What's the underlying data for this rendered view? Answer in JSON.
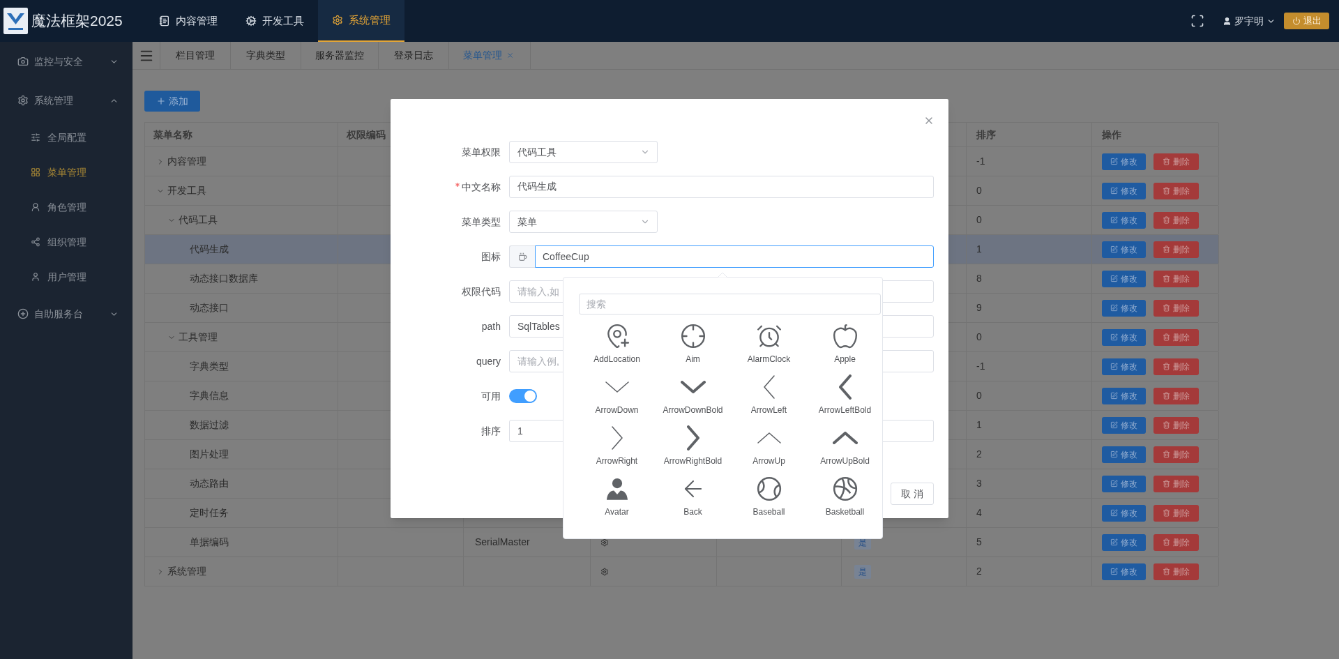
{
  "header": {
    "title": "魔法框架2025",
    "nav": [
      {
        "label": "内容管理",
        "selected": false
      },
      {
        "label": "开发工具",
        "selected": false
      },
      {
        "label": "系统管理",
        "selected": true
      }
    ],
    "user": "罗宇明",
    "logout": "退出"
  },
  "sidebar": {
    "items": [
      {
        "label": "监控与安全",
        "expanded": false
      },
      {
        "label": "系统管理",
        "expanded": true,
        "children": [
          {
            "label": "全局配置",
            "selected": false
          },
          {
            "label": "菜单管理",
            "selected": true
          },
          {
            "label": "角色管理",
            "selected": false
          },
          {
            "label": "组织管理",
            "selected": false
          },
          {
            "label": "用户管理",
            "selected": false
          }
        ]
      },
      {
        "label": "自助服务台",
        "expanded": false
      }
    ]
  },
  "tabs": [
    {
      "label": "栏目管理",
      "selected": false,
      "closable": false
    },
    {
      "label": "字典类型",
      "selected": false,
      "closable": false
    },
    {
      "label": "服务器监控",
      "selected": false,
      "closable": false
    },
    {
      "label": "登录日志",
      "selected": false,
      "closable": false
    },
    {
      "label": "菜单管理",
      "selected": true,
      "closable": true
    }
  ],
  "add_button": "添加",
  "table": {
    "columns": {
      "name": "菜单名称",
      "permission_code": "权限编码",
      "sort": "排序",
      "actions": "操作"
    },
    "rows": [
      {
        "name": "内容管理",
        "expanded": false,
        "selected": false,
        "sort": "-1",
        "actions": [
          "修改",
          "删除"
        ]
      },
      {
        "name": "开发工具",
        "expanded": true,
        "selected": false,
        "sort": "0",
        "actions": [
          "修改",
          "删除"
        ],
        "children": [
          {
            "name": "代码工具",
            "expanded": true,
            "selected": false,
            "sort": "0",
            "actions": [
              "修改",
              "删除"
            ],
            "children": [
              {
                "name": "代码生成",
                "selected": true,
                "sort": "1",
                "actions": [
                  "修改",
                  "删除"
                ]
              },
              {
                "name": "动态接口数据库",
                "selected": false,
                "sort": "8",
                "actions": [
                  "修改",
                  "删除"
                ]
              },
              {
                "name": "动态接口",
                "selected": false,
                "sort": "9",
                "actions": [
                  "修改",
                  "删除"
                ]
              }
            ]
          },
          {
            "name": "工具管理",
            "expanded": true,
            "selected": false,
            "sort": "0",
            "actions": [
              "修改",
              "删除"
            ],
            "children": [
              {
                "name": "字典类型",
                "selected": false,
                "sort": "-1",
                "actions": [
                  "修改",
                  "删除"
                ]
              },
              {
                "name": "字典信息",
                "selected": false,
                "sort": "0",
                "actions": [
                  "修改",
                  "删除"
                ]
              },
              {
                "name": "数据过滤",
                "selected": false,
                "sort": "1",
                "actions": [
                  "修改",
                  "删除"
                ]
              },
              {
                "name": "图片处理",
                "selected": false,
                "sort": "2",
                "actions": [
                  "修改",
                  "删除"
                ]
              },
              {
                "name": "动态路由",
                "selected": false,
                "sort": "3",
                "actions": [
                  "修改",
                  "删除"
                ]
              },
              {
                "name": "定时任务",
                "selected": false,
                "sort": "4",
                "actions": [
                  "修改",
                  "删除"
                ]
              },
              {
                "name": "单据编码",
                "selected": false,
                "sort": "5",
                "column_3": "SerialMaster",
                "menu_icon": true,
                "column_6": "是",
                "actions": [
                  "修改",
                  "删除"
                ]
              }
            ]
          }
        ]
      },
      {
        "name": "系统管理",
        "expanded": false,
        "selected": false,
        "sort": "2",
        "menu_icon": true,
        "column_6": "是",
        "actions": [
          "修改",
          "删除"
        ]
      }
    ]
  },
  "dialog": {
    "fields": [
      {
        "kind": "select",
        "label": "菜单权限",
        "required": false,
        "value": "代码工具"
      },
      {
        "kind": "text",
        "label": "中文名称",
        "required": true,
        "value": "代码生成"
      },
      {
        "kind": "select",
        "label": "菜单类型",
        "required": false,
        "value": "菜单"
      },
      {
        "kind": "icon",
        "label": "图标",
        "required": false,
        "value": "CoffeeCup"
      },
      {
        "kind": "text",
        "label": "权限代码",
        "required": false,
        "placeholder": "请输入,如"
      },
      {
        "kind": "text",
        "label": "path",
        "required": false,
        "value": "SqlTables"
      },
      {
        "kind": "text",
        "label": "query",
        "required": false,
        "placeholder": "请输入例,"
      },
      {
        "kind": "switch",
        "label": "可用",
        "required": false,
        "on": true
      },
      {
        "kind": "text",
        "label": "排序",
        "required": false,
        "value": "1"
      }
    ],
    "cancel": "取 消"
  },
  "icon_picker": {
    "placeholder": "搜索",
    "icons": [
      "AddLocation",
      "Aim",
      "AlarmClock",
      "Apple",
      "ArrowDown",
      "ArrowDownBold",
      "ArrowLeft",
      "ArrowLeftBold",
      "ArrowRight",
      "ArrowRightBold",
      "ArrowUp",
      "ArrowUpBold",
      "Avatar",
      "Back",
      "Baseball",
      "Basketball"
    ]
  }
}
